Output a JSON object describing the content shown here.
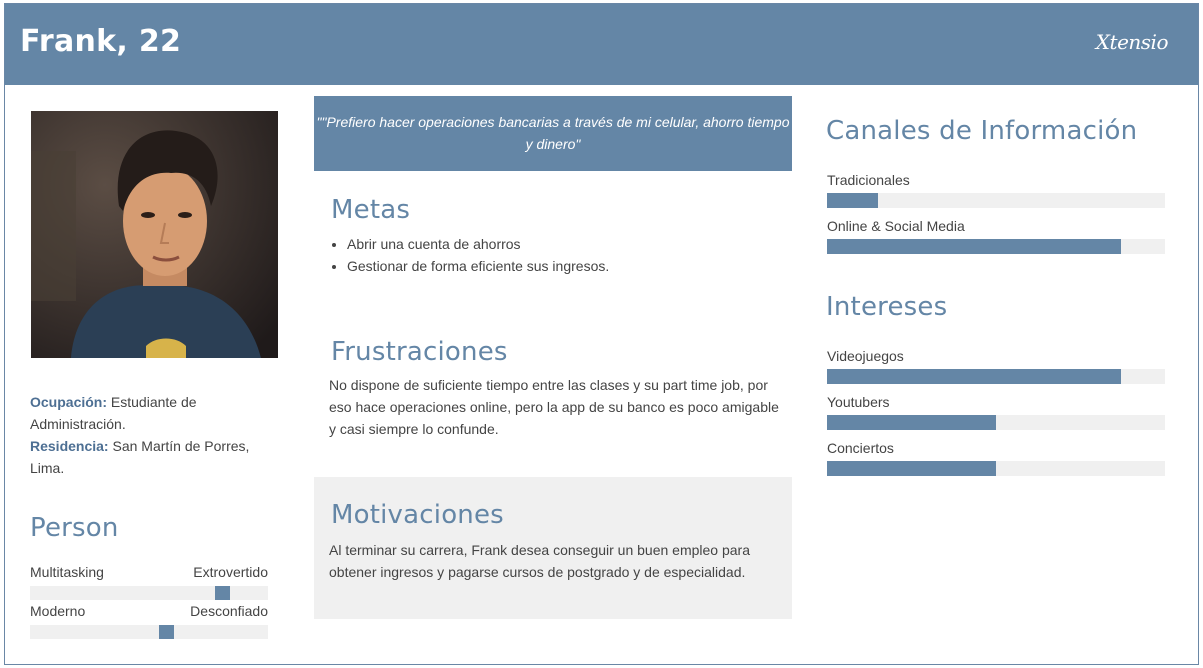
{
  "header": {
    "name": "Frank, 22",
    "logo": "Xtensio"
  },
  "profile": {
    "occupation_label": "Ocupación:",
    "occupation_value": " Estudiante de Administración.",
    "residence_label": "Residencia:",
    "residence_value": " San Martín de Porres, Lima."
  },
  "person": {
    "title": "Person",
    "sliders": [
      {
        "left": "Multitasking",
        "right": "Extrovertido",
        "value": 0.83
      },
      {
        "left": "Moderno",
        "right": "Desconfiado",
        "value": 0.58
      }
    ]
  },
  "quote": "\"\"Prefiero hacer operaciones bancarias a través de mi celular, ahorro tiempo y dinero\"",
  "metas": {
    "title": "Metas",
    "items": [
      "Abrir una cuenta de ahorros",
      "Gestionar de forma eficiente sus ingresos."
    ]
  },
  "frustraciones": {
    "title": "Frustraciones",
    "text": "No dispone de suficiente tiempo entre las clases y su part time job, por eso hace operaciones online, pero la app de su banco es poco amigable y casi siempre lo confunde."
  },
  "motivaciones": {
    "title": "Motivaciones",
    "text": "Al terminar su carrera, Frank desea conseguir un buen empleo para obtener ingresos y pagarse cursos de postgrado y de especialidad."
  },
  "canales": {
    "title": "Canales de Información",
    "bars": [
      {
        "label": "Tradicionales",
        "value": 0.15
      },
      {
        "label": "Online & Social Media",
        "value": 0.87
      }
    ]
  },
  "intereses": {
    "title": "Intereses",
    "bars": [
      {
        "label": "Videojuegos",
        "value": 0.87
      },
      {
        "label": "Youtubers",
        "value": 0.5
      },
      {
        "label": "Conciertos",
        "value": 0.5
      }
    ]
  },
  "colors": {
    "accent": "#6486a6",
    "track": "#f0f0f0",
    "label": "#4d6f93"
  }
}
